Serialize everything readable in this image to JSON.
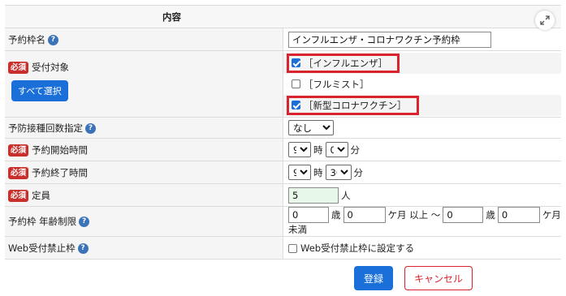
{
  "table": {
    "header_label": "",
    "header_value": "内容"
  },
  "rows": {
    "name": {
      "label": "予約枠名",
      "value": "インフルエンザ・コロナワクチン予約枠"
    },
    "target": {
      "required": "必須",
      "label": "受付対象",
      "select_all": "すべて選択",
      "options": [
        {
          "label": "［インフルエンザ］",
          "checked": true
        },
        {
          "label": "［フルミスト］",
          "checked": false
        },
        {
          "label": "［新型コロナワクチン］",
          "checked": true
        }
      ]
    },
    "dose": {
      "label": "予防接種回数指定",
      "value": "なし"
    },
    "start": {
      "required": "必須",
      "label": "予約開始時間",
      "hour": "9",
      "hour_unit": "時",
      "minute": "0",
      "minute_unit": "分"
    },
    "end": {
      "required": "必須",
      "label": "予約終了時間",
      "hour": "9",
      "hour_unit": "時",
      "minute": "30",
      "minute_unit": "分"
    },
    "capacity": {
      "required": "必須",
      "label": "定員",
      "value": "5",
      "unit": "人"
    },
    "age": {
      "label": "予約枠 年齢制限",
      "from_years": "0",
      "years_unit": "歳",
      "from_months": "0",
      "months_unit": "ケ月 以上 ～",
      "to_years": "0",
      "to_years_unit": "歳",
      "to_months": "0",
      "to_months_unit": "ケ月 未満"
    },
    "web": {
      "label": "Web受付禁止枠",
      "checkbox_label": "Web受付禁止枠に設定する",
      "checked": false
    }
  },
  "buttons": {
    "register": "登録",
    "cancel": "キャンセル"
  },
  "icons": {
    "help": "help-circle-icon",
    "expand": "expand-icon"
  },
  "colors": {
    "primary": "#1a6fd8",
    "danger": "#d9232d",
    "required_badge": "#c9302c"
  }
}
